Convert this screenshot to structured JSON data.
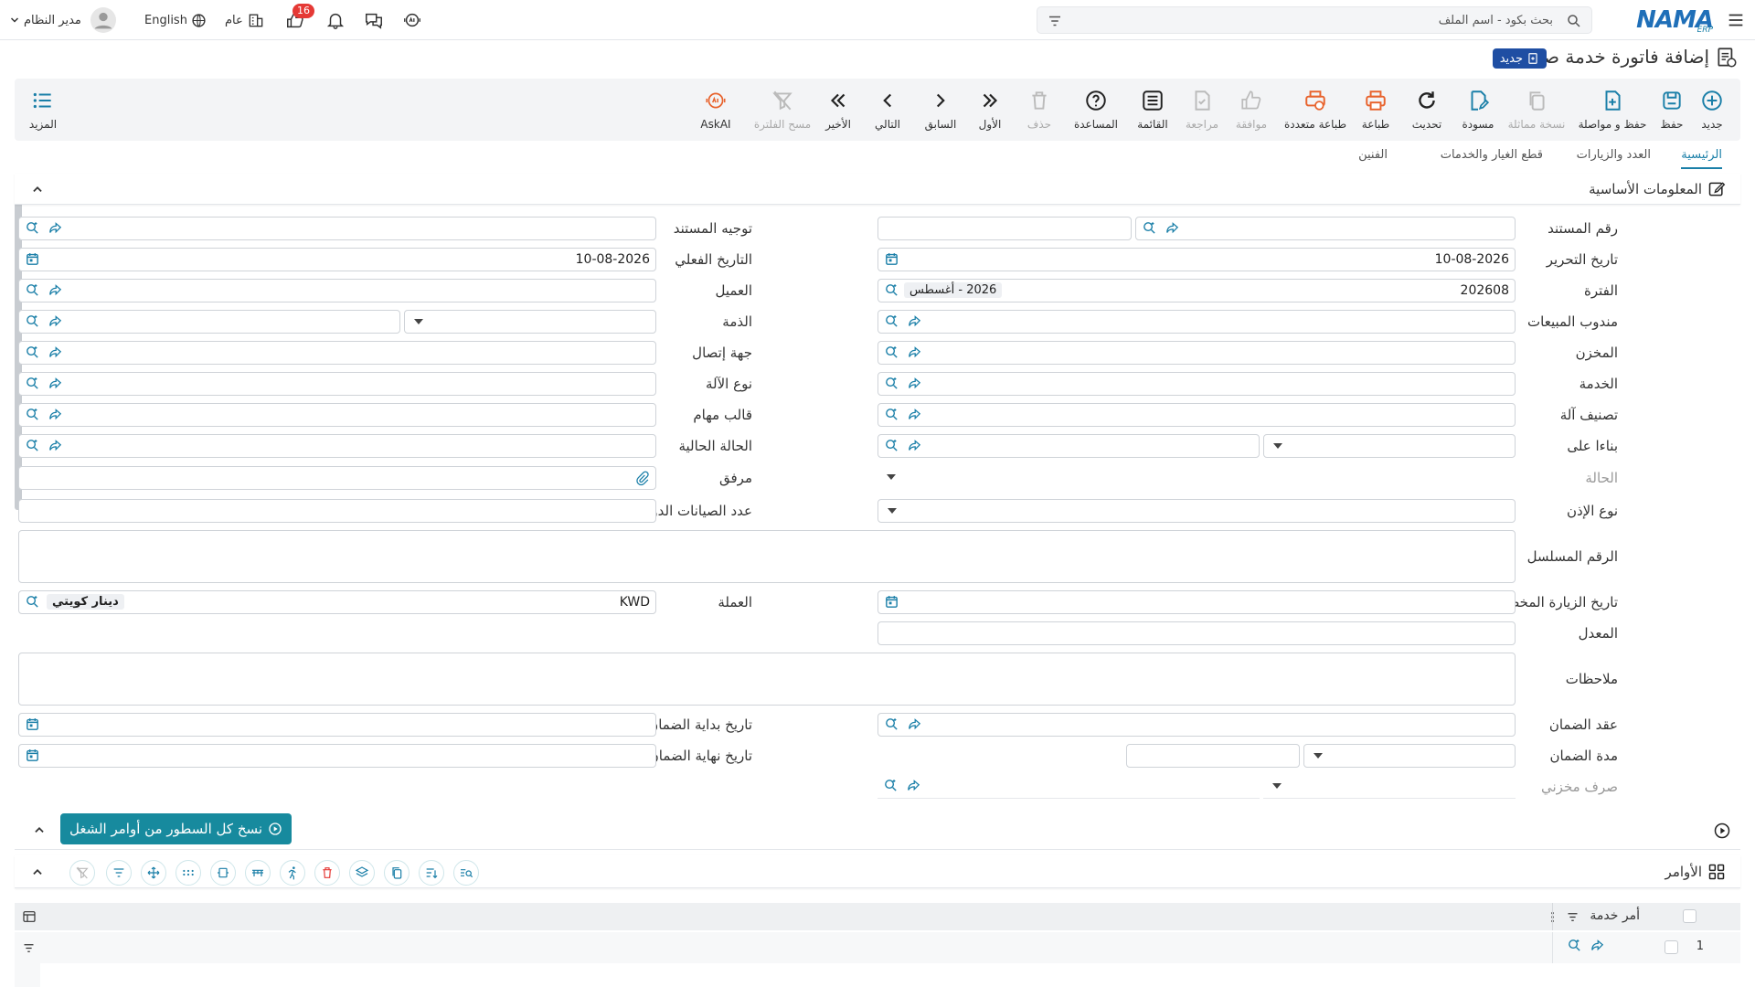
{
  "topbar": {
    "app_logo": "NAMA",
    "app_logo_sub": "ERP",
    "search_placeholder": "بحث بكود - اسم الملف",
    "user_name": "مدير النظام",
    "language": "English",
    "scope": "عام",
    "notification_count": "16"
  },
  "page": {
    "title": "إضافة فاتورة خدمة صيانة",
    "status_badge": "جديد"
  },
  "toolbar": {
    "new": "جديد",
    "save": "حفظ",
    "save_continue": "حفظ و مواصلة",
    "duplicate": "نسخة مماثلة",
    "draft": "مسودة",
    "refresh": "تحديث",
    "print": "طباعة",
    "multi_print": "طباعة متعددة",
    "approve": "موافقة",
    "review": "مراجعة",
    "list": "القائمة",
    "help": "المساعدة",
    "delete": "حذف",
    "first": "الأول",
    "previous": "السابق",
    "next": "التالي",
    "last": "الأخير",
    "clear_filter": "مسح الفلترة",
    "askai": "AskAI",
    "more": "المزيد"
  },
  "tabs": [
    "الرئيسية",
    "العدد والزيارات",
    "قطع الغيار والخدمات",
    "الفنين"
  ],
  "section_basic": "المعلومات الأساسية",
  "form": {
    "doc_number": "رقم المستند",
    "doc_direction": "توجيه المستند",
    "edit_date": "تاريخ التحرير",
    "edit_date_value": "10-08-2026",
    "actual_date": "التاريخ الفعلي",
    "actual_date_value": "10-08-2026",
    "period": "الفترة",
    "period_value": "202608",
    "period_chip": "2026 - أغسطس",
    "customer": "العميل",
    "sales_rep": "مندوب المبيعات",
    "liability": "الذمة",
    "warehouse": "المخزن",
    "contact": "جهة إتصال",
    "service": "الخدمة",
    "machine_type": "نوع الآلة",
    "machine_class": "تصنيف آلة",
    "task_template": "قالب مهام",
    "based_on": "بناءا على",
    "current_status": "الحالة الحالية",
    "status": "الحالة",
    "attachment": "مرفق",
    "permit_type": "نوع الإذن",
    "periodic_count": "عدد الصيانات الدورية",
    "serial_number": "الرقم المسلسل",
    "planned_visit_date": "تاريخ الزيارة المخطط",
    "currency": "العملة",
    "currency_value": "KWD",
    "currency_chip": "دينار كويتي",
    "rate": "المعدل",
    "notes": "ملاحظات",
    "warranty_contract": "عقد الضمان",
    "warranty_start": "تاريخ بداية الضمان",
    "warranty_period": "مدة الضمان",
    "warranty_end": "تاريخ نهاية الضمان",
    "stock_issue": "صرف مخزني"
  },
  "copy_lines_button": "نسخ كل السطور من أوامر الشغل",
  "orders_section": "الأوامر",
  "grid": {
    "col_service_order": "أمر خدمة",
    "row_number": "1"
  },
  "colors": {
    "accent": "#1a7fa8",
    "brand": "#1f4ea3",
    "copy_button": "#178a9e",
    "print_orange": "#e8622c"
  }
}
